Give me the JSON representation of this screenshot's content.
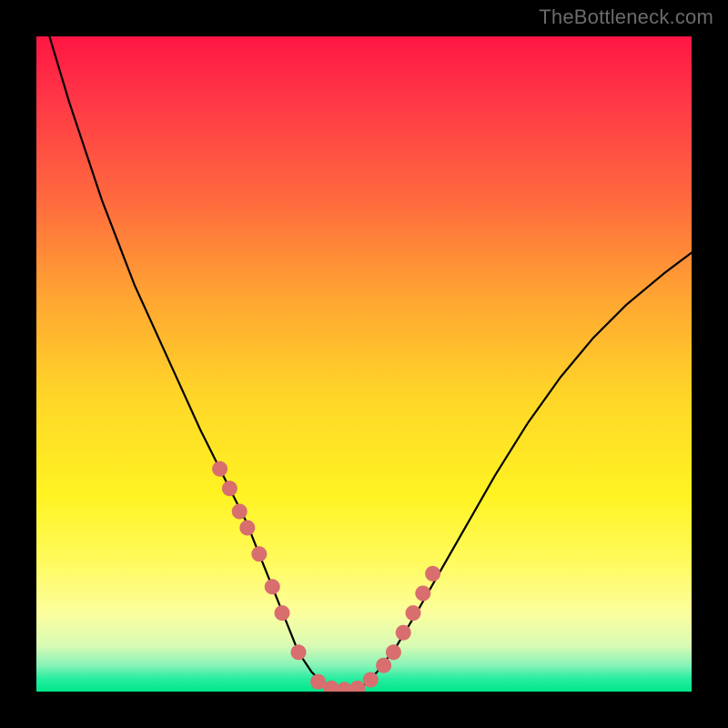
{
  "watermark": "TheBottleneck.com",
  "chart_data": {
    "type": "line",
    "title": "",
    "xlabel": "",
    "ylabel": "",
    "ylim": [
      0,
      100
    ],
    "xlim": [
      0,
      100
    ],
    "series": [
      {
        "name": "bottleneck-curve",
        "x": [
          2,
          5,
          10,
          15,
          20,
          25,
          28,
          30,
          32,
          34,
          36,
          38,
          40,
          42,
          44,
          46,
          48,
          50,
          52,
          55,
          58,
          62,
          66,
          70,
          75,
          80,
          85,
          90,
          96,
          100
        ],
        "y": [
          100,
          90,
          75,
          62,
          51,
          40,
          34,
          30,
          26,
          21,
          16,
          11,
          6,
          3,
          1,
          0,
          0,
          1,
          3,
          7,
          12,
          19,
          26,
          33,
          41,
          48,
          54,
          59,
          64,
          67
        ]
      }
    ],
    "markers": {
      "name": "highlight-dots",
      "color": "#d86e6e",
      "x": [
        28,
        29.5,
        31,
        32.2,
        34,
        36,
        37.5,
        40,
        43,
        45,
        47,
        49,
        51,
        53,
        54.5,
        56,
        57.5,
        59,
        60.5
      ],
      "y": [
        34,
        31,
        27.5,
        25,
        21,
        16,
        12,
        6,
        1.5,
        0.5,
        0.3,
        0.5,
        1.8,
        4,
        6,
        9,
        12,
        15,
        18
      ]
    }
  }
}
